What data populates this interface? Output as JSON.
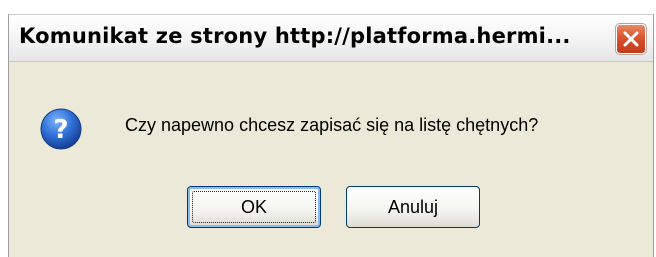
{
  "dialog": {
    "title": "Komunikat ze strony http://platforma.hermi...",
    "message": "Czy napewno chcesz zapisać się na listę chętnych?",
    "icon": "question-icon",
    "close_icon": "close-icon",
    "buttons": {
      "ok_label": "OK",
      "cancel_label": "Anuluj"
    },
    "colors": {
      "close_button": "#d9532f",
      "icon_blue": "#1f5fbf",
      "button_border": "#003c74"
    }
  }
}
